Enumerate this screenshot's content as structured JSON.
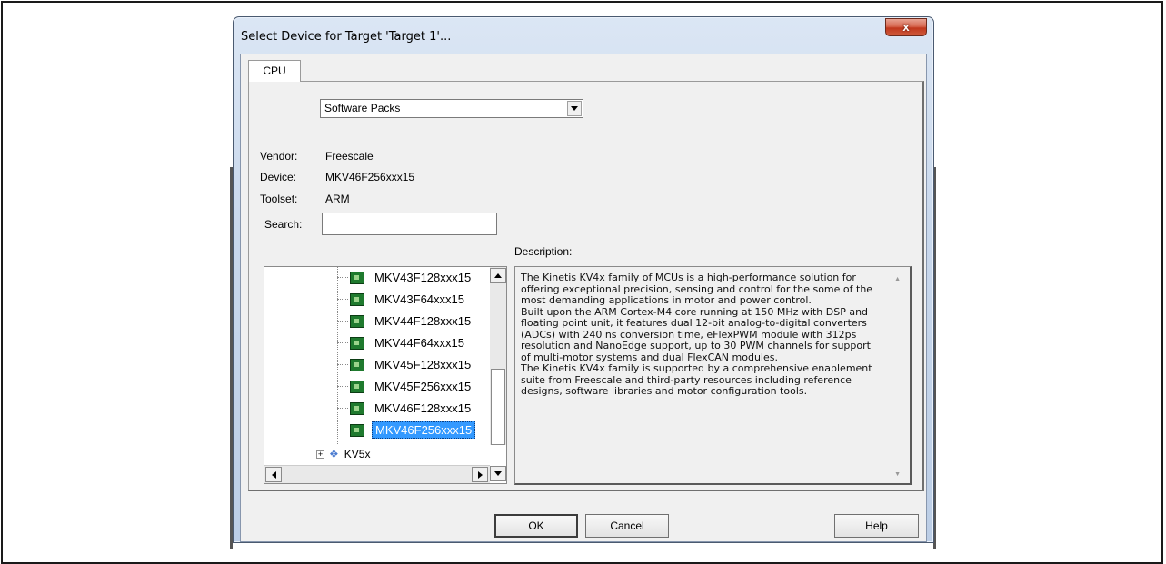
{
  "window": {
    "title": "Select Device for Target 'Target 1'...",
    "close_label": "x"
  },
  "tabs": [
    {
      "label": "CPU",
      "active": true
    }
  ],
  "pack_selector": {
    "selected": "Software Packs"
  },
  "fields": {
    "vendor_label": "Vendor:",
    "vendor_value": "Freescale",
    "device_label": "Device:",
    "device_value": "MKV46F256xxx15",
    "toolset_label": "Toolset:",
    "toolset_value": "ARM",
    "search_label": "Search:",
    "search_value": ""
  },
  "description_label": "Description:",
  "device_tree": {
    "items": [
      {
        "label": "MKV43F128xxx15"
      },
      {
        "label": "MKV43F64xxx15"
      },
      {
        "label": "MKV44F128xxx15"
      },
      {
        "label": "MKV44F64xxx15"
      },
      {
        "label": "MKV45F128xxx15"
      },
      {
        "label": "MKV45F256xxx15"
      },
      {
        "label": "MKV46F128xxx15"
      },
      {
        "label": "MKV46F256xxx15",
        "selected": true
      }
    ],
    "group_label": "KV5x"
  },
  "description": "The Kinetis KV4x family of MCUs is a high-performance solution for\noffering exceptional precision, sensing and control for the some of the\nmost demanding applications in motor and power control.\nBuilt upon the ARM Cortex-M4 core running at 150 MHz with DSP and\nfloating point unit, it features dual 12-bit analog-to-digital converters\n(ADCs) with 240 ns conversion time, eFlexPWM module with 312ps\nresolution and NanoEdge support, up to 30 PWM channels for support\nof multi-motor systems and dual FlexCAN modules.\nThe Kinetis KV4x family is supported by a comprehensive enablement\nsuite from Freescale and third-party resources including reference\ndesigns, software libraries and motor configuration tools.",
  "buttons": {
    "ok": "OK",
    "cancel": "Cancel",
    "help": "Help"
  },
  "icons": {
    "device": "chip-icon",
    "group": "folder-icon",
    "expand": "plus-icon"
  }
}
